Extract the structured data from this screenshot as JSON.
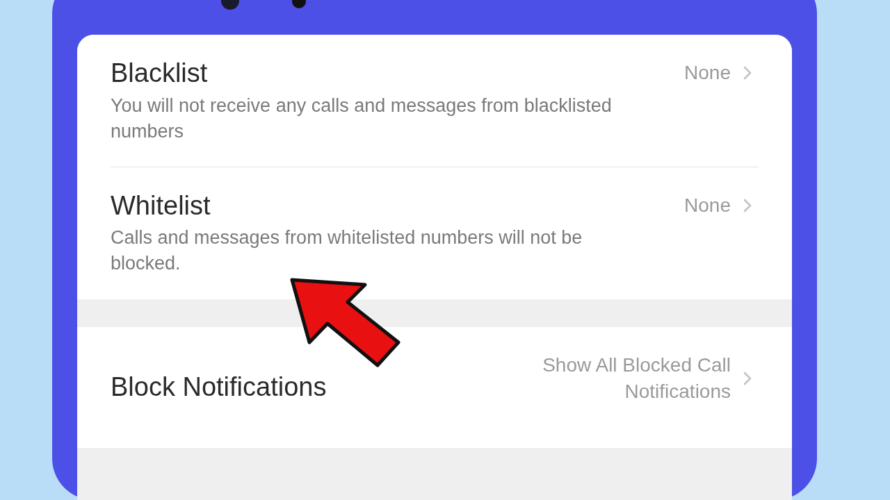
{
  "groups": [
    {
      "items": [
        {
          "title": "Blacklist",
          "description": "You will not receive any calls and messages from blacklisted numbers",
          "value": "None"
        },
        {
          "title": "Whitelist",
          "description": "Calls and messages from whitelisted numbers will not be blocked.",
          "value": "None"
        }
      ]
    },
    {
      "items": [
        {
          "title": "Block Notifications",
          "value": "Show All Blocked Call Notifications"
        }
      ]
    }
  ]
}
